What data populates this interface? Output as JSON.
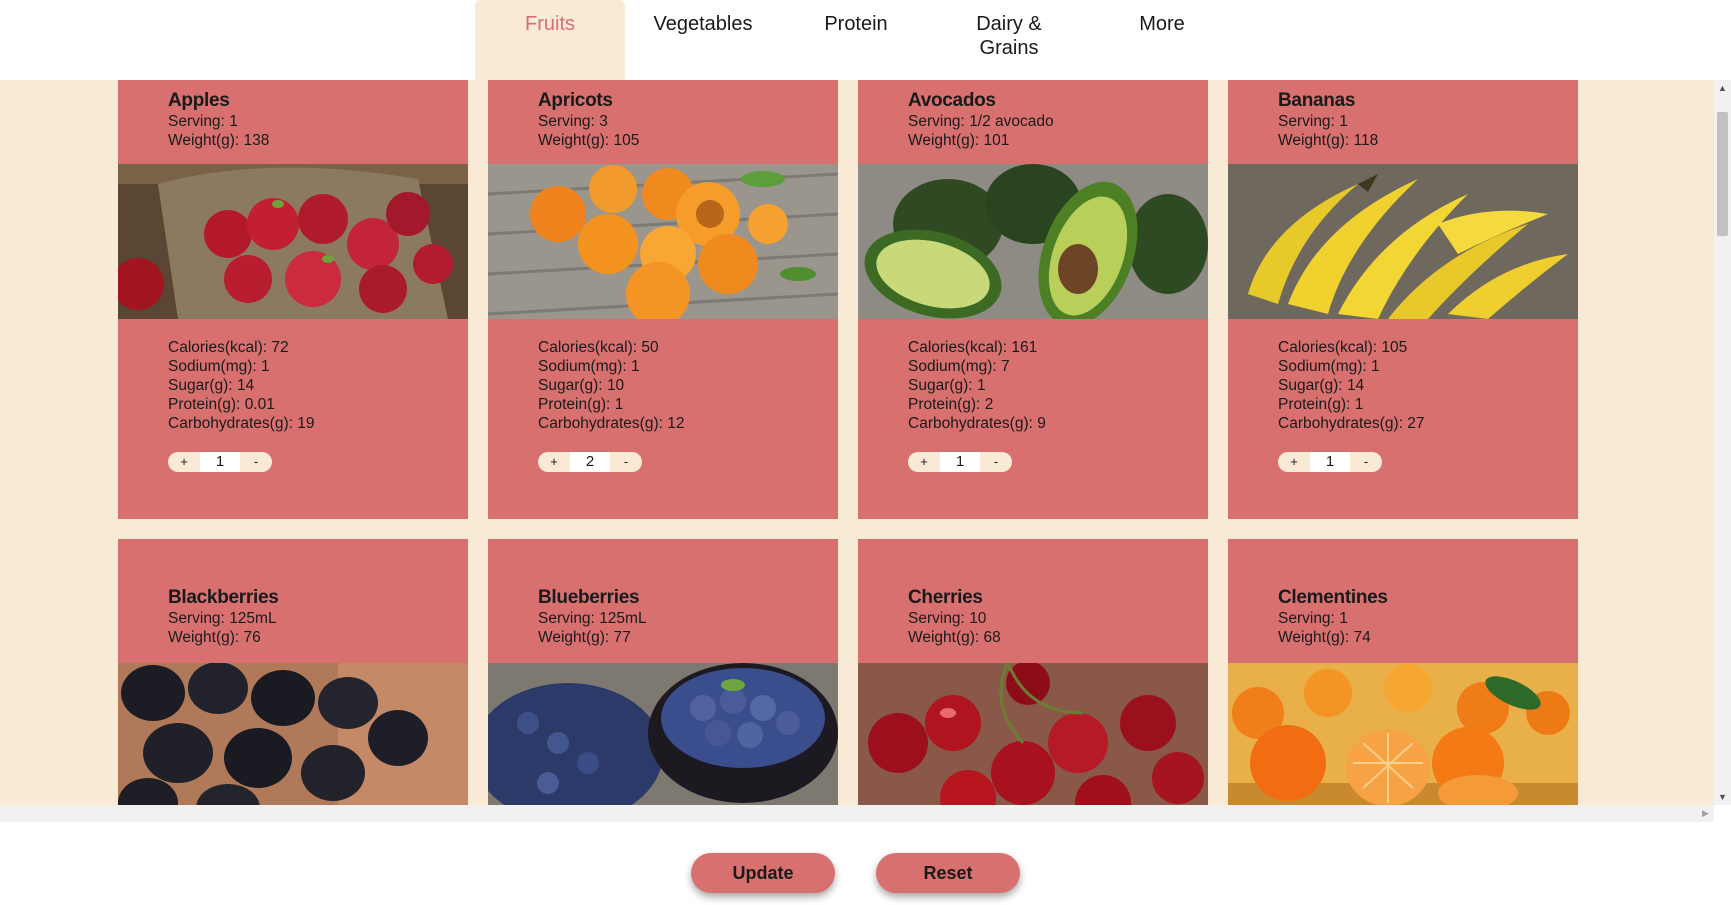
{
  "tabs": [
    {
      "label": "Fruits",
      "active": true
    },
    {
      "label": "Vegetables",
      "active": false
    },
    {
      "label": "Protein",
      "active": false
    },
    {
      "label": "Dairy &\nGrains",
      "active": false
    },
    {
      "label": "More",
      "active": false
    }
  ],
  "labels": {
    "serving": "Serving:",
    "weight": "Weight(g):",
    "calories": "Calories(kcal):",
    "sodium": "Sodium(mg):",
    "sugar": "Sugar(g):",
    "protein": "Protein(g):",
    "carbohydrates": "Carbohydrates(g):",
    "plus": "+",
    "minus": "-"
  },
  "foods": [
    {
      "name": "Apples",
      "serving": "1",
      "weight": "138",
      "calories": "72",
      "sodium": "1",
      "sugar": "14",
      "protein": "0.01",
      "carbohydrates": "19",
      "quantity": "1",
      "image": "apples-photo"
    },
    {
      "name": "Apricots",
      "serving": "3",
      "weight": "105",
      "calories": "50",
      "sodium": "1",
      "sugar": "10",
      "protein": "1",
      "carbohydrates": "12",
      "quantity": "2",
      "image": "apricots-photo"
    },
    {
      "name": "Avocados",
      "serving": "1/2 avocado",
      "weight": "101",
      "calories": "161",
      "sodium": "7",
      "sugar": "1",
      "protein": "2",
      "carbohydrates": "9",
      "quantity": "1",
      "image": "avocados-photo"
    },
    {
      "name": "Bananas",
      "serving": "1",
      "weight": "118",
      "calories": "105",
      "sodium": "1",
      "sugar": "14",
      "protein": "1",
      "carbohydrates": "27",
      "quantity": "1",
      "image": "bananas-photo"
    },
    {
      "name": "Blackberries",
      "serving": "125mL",
      "weight": "76",
      "image": "blackberries-photo"
    },
    {
      "name": "Blueberries",
      "serving": "125mL",
      "weight": "77",
      "image": "blueberries-photo"
    },
    {
      "name": "Cherries",
      "serving": "10",
      "weight": "68",
      "image": "cherries-photo"
    },
    {
      "name": "Clementines",
      "serving": "1",
      "weight": "74",
      "image": "clementines-photo"
    }
  ],
  "footer": {
    "update_label": "Update",
    "reset_label": "Reset"
  },
  "colors": {
    "accent": "#d97070",
    "background": "#f9ead6",
    "active_tab_text": "#d96f6f"
  },
  "icons": {
    "scroll_up": "triangle-up-icon",
    "scroll_down": "triangle-down-icon",
    "scroll_right": "triangle-right-icon"
  }
}
